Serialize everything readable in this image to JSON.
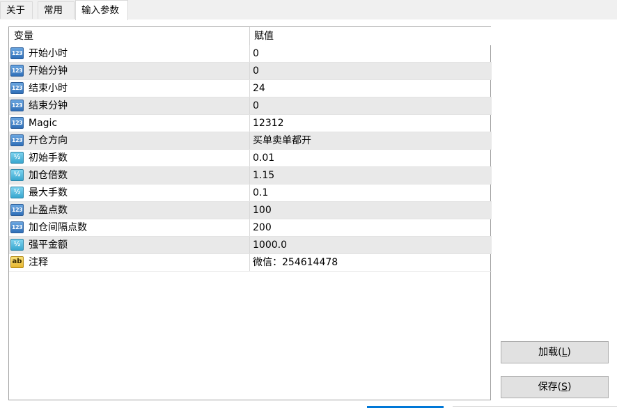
{
  "tabs": [
    {
      "label": "关于",
      "active": false
    },
    {
      "label": "常用",
      "active": false
    },
    {
      "label": "输入参数",
      "active": true
    }
  ],
  "grid": {
    "header": {
      "variable": "变量",
      "value": "赋值"
    },
    "rows": [
      {
        "icon": "int-icon",
        "badge": "123",
        "name": "开始小时",
        "value": "0"
      },
      {
        "icon": "int-icon",
        "badge": "123",
        "name": "开始分钟",
        "value": "0"
      },
      {
        "icon": "int-icon",
        "badge": "123",
        "name": "结束小时",
        "value": "24"
      },
      {
        "icon": "int-icon",
        "badge": "123",
        "name": "结束分钟",
        "value": "0"
      },
      {
        "icon": "int-icon",
        "badge": "123",
        "name": "Magic",
        "value": "12312"
      },
      {
        "icon": "int-icon",
        "badge": "123",
        "name": "开仓方向",
        "value": "买单卖单都开"
      },
      {
        "icon": "double-icon",
        "badge": "½",
        "name": "初始手数",
        "value": "0.01"
      },
      {
        "icon": "double-icon",
        "badge": "½",
        "name": "加仓倍数",
        "value": "1.15"
      },
      {
        "icon": "double-icon",
        "badge": "½",
        "name": "最大手数",
        "value": "0.1"
      },
      {
        "icon": "int-icon",
        "badge": "123",
        "name": "止盈点数",
        "value": "100"
      },
      {
        "icon": "int-icon",
        "badge": "123",
        "name": "加仓间隔点数",
        "value": "200"
      },
      {
        "icon": "double-icon",
        "badge": "½",
        "name": "强平金额",
        "value": "1000.0"
      },
      {
        "icon": "string-icon",
        "badge": "ab",
        "name": "注释",
        "value": "微信：254614478"
      }
    ]
  },
  "buttons": {
    "load": {
      "text": "加载(",
      "hotkey": "L",
      "end": ")"
    },
    "save": {
      "text": "保存(",
      "hotkey": "S",
      "end": ")"
    }
  },
  "colors": {
    "accent": "#0078d7",
    "row_alt": "#e9e9e9",
    "int_icon": "#2f6fb8",
    "double_icon": "#38a6cf",
    "string_icon": "#e7b630"
  }
}
